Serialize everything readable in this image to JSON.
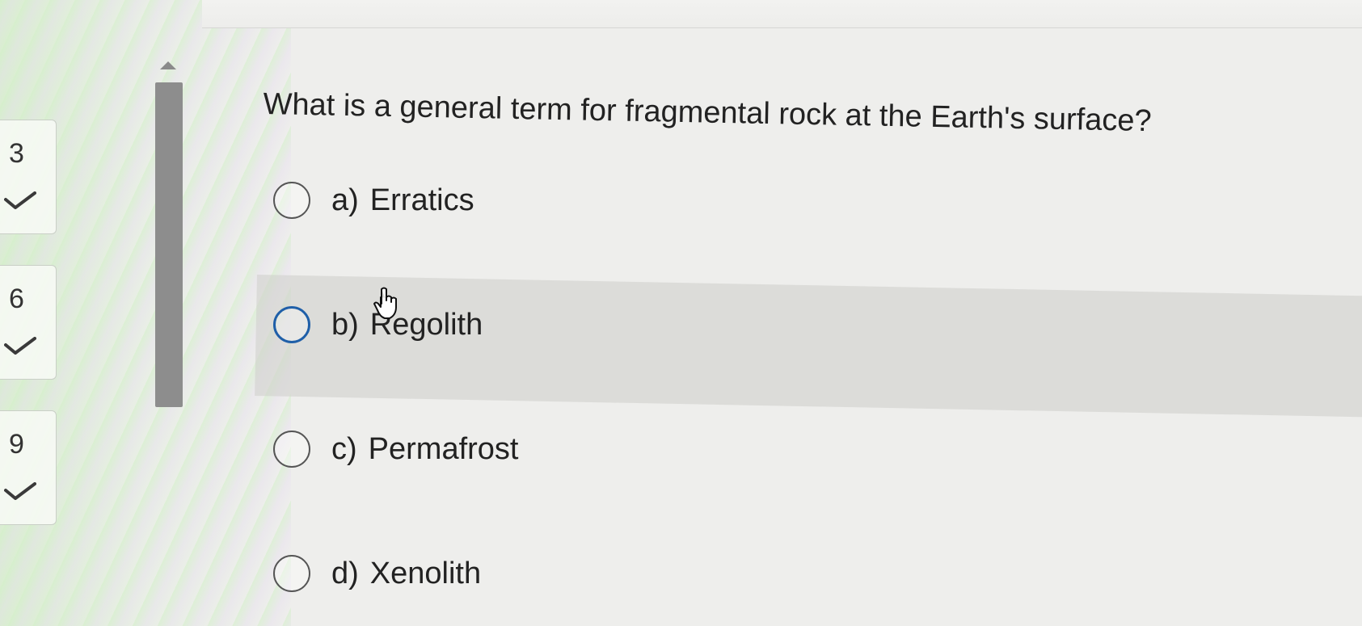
{
  "navigator": {
    "items": [
      {
        "number": "3",
        "status_icon": "checkmark-icon"
      },
      {
        "number": "6",
        "status_icon": "checkmark-icon"
      },
      {
        "number": "9",
        "status_icon": "checkmark-icon"
      }
    ]
  },
  "question": {
    "text": "What is a general term for fragmental rock at the Earth's surface?",
    "options": [
      {
        "letter": "a)",
        "text": "Erratics",
        "hovered": false
      },
      {
        "letter": "b)",
        "text": "Regolith",
        "hovered": true
      },
      {
        "letter": "c)",
        "text": "Permafrost",
        "hovered": false
      },
      {
        "letter": "d)",
        "text": "Xenolith",
        "hovered": false
      }
    ]
  },
  "colors": {
    "radio_hover": "#1f5fa8",
    "radio_border": "#555555",
    "text": "#222222",
    "scrollbar": "#8d8d8d"
  }
}
